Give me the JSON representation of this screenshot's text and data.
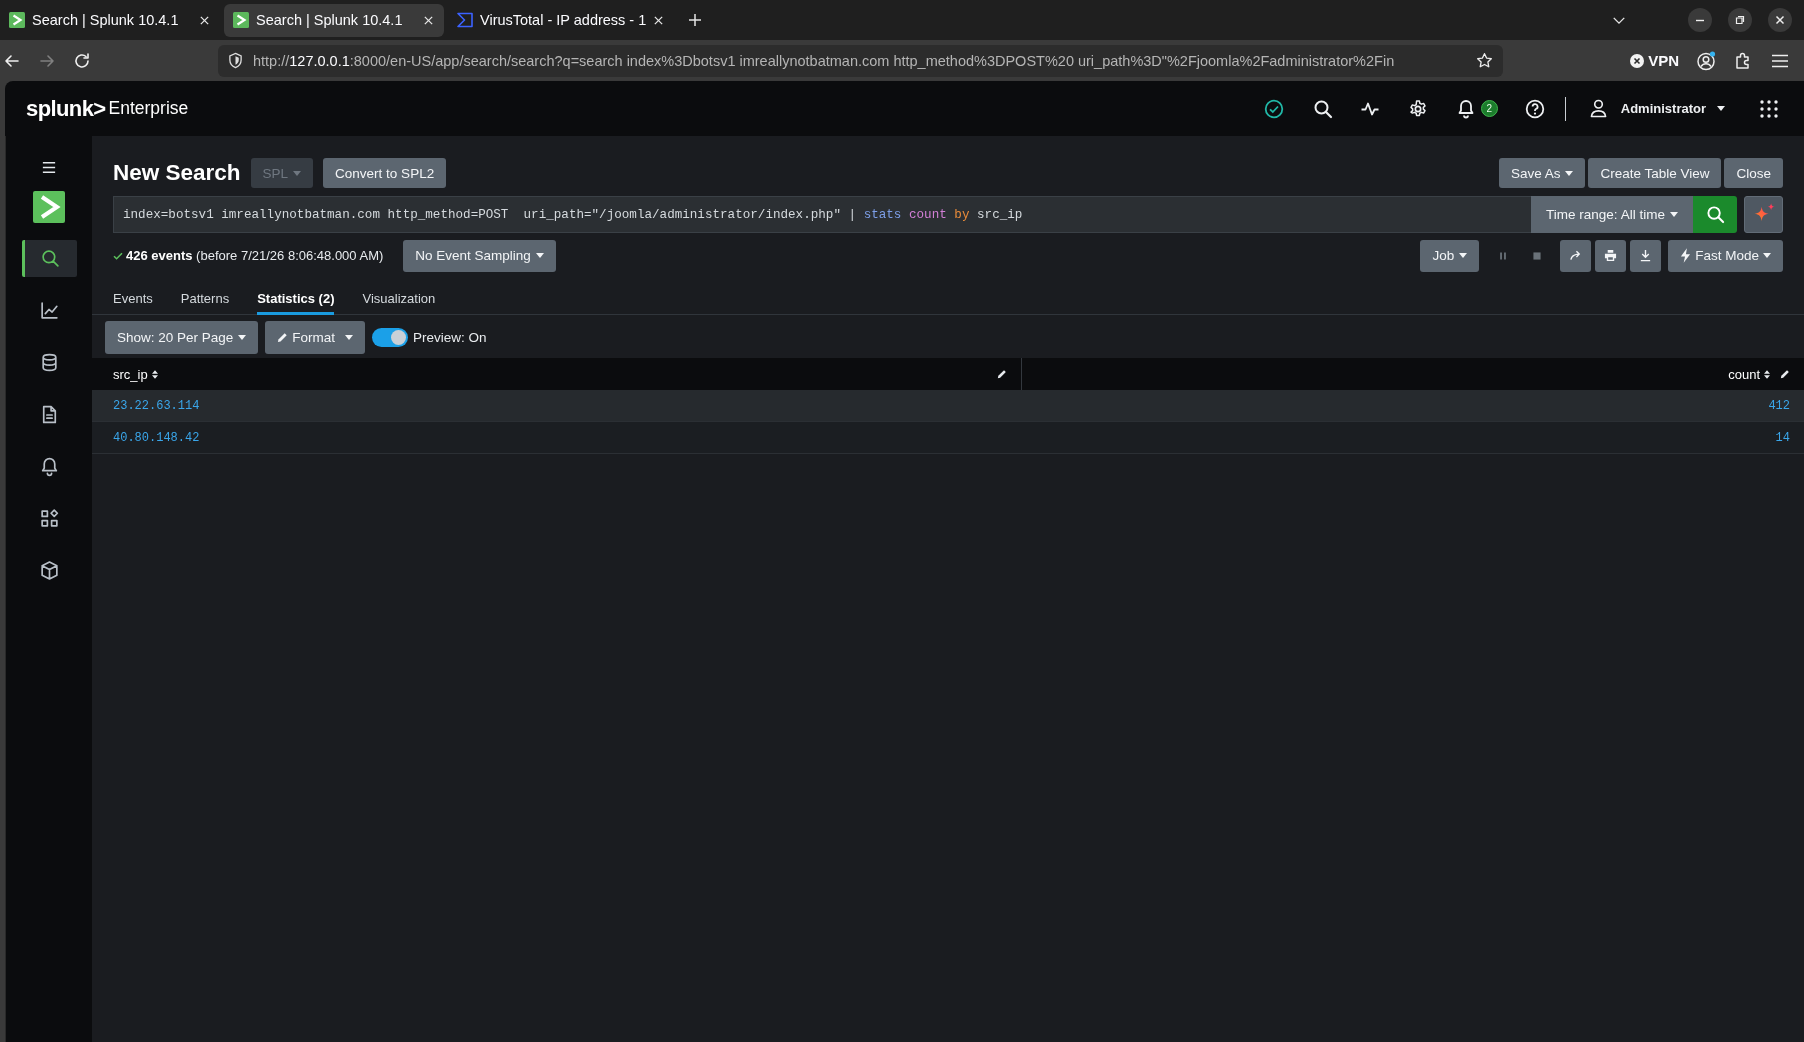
{
  "browser": {
    "tabs": [
      {
        "kind": "splunk",
        "title": "Search | Splunk 10.4.1",
        "selected": false
      },
      {
        "kind": "splunk",
        "title": "Search | Splunk 10.4.1",
        "selected": true
      },
      {
        "kind": "virustotal",
        "title": "VirusTotal - IP address - 1",
        "selected": false
      }
    ],
    "nav": [
      {
        "kind": "back",
        "disabled": false
      },
      {
        "kind": "forward",
        "disabled": true
      },
      {
        "kind": "reload",
        "disabled": false
      }
    ],
    "url": {
      "scheme": "http://",
      "host": "127.0.0.1",
      "rest": ":8000/en-US/app/search/search?q=search index%3Dbotsv1 imreallynotbatman.com http_method%3DPOST%20 uri_path%3D\"%2Fjoomla%2Fadministrator%2Fin"
    },
    "vpn": "VPN"
  },
  "header": {
    "logo": "splunk>",
    "product": "Enterprise",
    "notifications": "2",
    "user": "Administrator"
  },
  "sidebar": {
    "items": [
      {
        "kind": "search",
        "selected": true
      },
      {
        "kind": "chart",
        "selected": false
      },
      {
        "kind": "database",
        "selected": false
      },
      {
        "kind": "document",
        "selected": false
      },
      {
        "kind": "bell",
        "selected": false
      },
      {
        "kind": "apps",
        "selected": false
      },
      {
        "kind": "box",
        "selected": false
      }
    ]
  },
  "search": {
    "title": "New Search",
    "language": {
      "label": "SPL",
      "disabled": true
    },
    "convert": "Convert to SPL2",
    "actions": [
      {
        "label": "Save As",
        "dropdown": true
      },
      {
        "label": "Create Table View",
        "dropdown": false
      },
      {
        "label": "Close",
        "dropdown": false
      }
    ],
    "query": [
      {
        "kind": "plain",
        "text": "index=botsv1 imreallynotbatman.com http_method=POST  uri_path=\"/joomla/administrator/index.php\" | "
      },
      {
        "kind": "command",
        "text": "stats"
      },
      {
        "kind": "function",
        "text": " count"
      },
      {
        "kind": "keyword",
        "text": " by"
      },
      {
        "kind": "plain",
        "text": " src_ip"
      }
    ],
    "time_range": "Time range: All time"
  },
  "status": {
    "summary": "**426 events** (before 7/21/26 8:06:48.000 AM)",
    "sampling": "No Event Sampling",
    "job": "Job",
    "controls": [
      {
        "kind": "pause",
        "disabled": true
      },
      {
        "kind": "stop",
        "disabled": true
      },
      {
        "kind": "share",
        "disabled": false
      },
      {
        "kind": "print",
        "disabled": false
      },
      {
        "kind": "export",
        "disabled": false
      }
    ],
    "mode": "Fast Mode"
  },
  "tabs": [
    {
      "label": "Events",
      "selected": false
    },
    {
      "label": "Patterns",
      "selected": false
    },
    {
      "label": "Statistics (2)",
      "selected": true
    },
    {
      "label": "Visualization",
      "selected": false
    }
  ],
  "toolbar": {
    "page_size": "Show: 20 Per Page",
    "format": "Format",
    "preview": {
      "label": "Preview: On",
      "on": true
    }
  },
  "table": {
    "columns": [
      {
        "label": "src_ip",
        "kind": "text"
      },
      {
        "label": "count",
        "kind": "number"
      }
    ],
    "rows": [
      [
        "23.22.63.114",
        "412"
      ],
      [
        "40.80.148.42",
        "14"
      ]
    ]
  }
}
